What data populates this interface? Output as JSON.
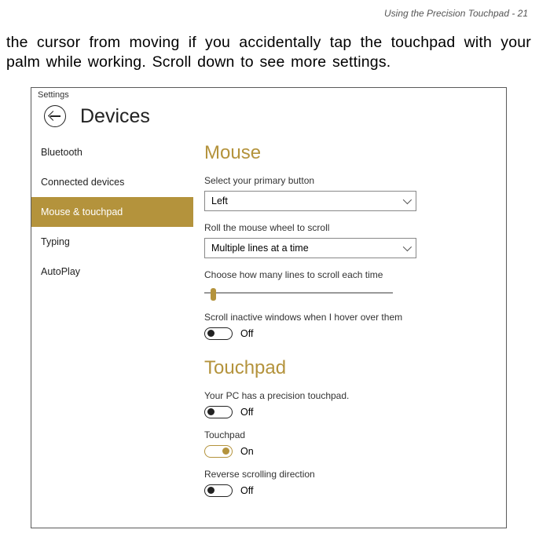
{
  "page_header": "Using the Precision Touchpad - 21",
  "body_text": "the cursor from moving if you accidentally tap the touchpad with your palm while working. Scroll down to see more settings.",
  "window_title": "Settings",
  "app_title": "Devices",
  "sidebar": {
    "items": [
      {
        "label": "Bluetooth",
        "active": false
      },
      {
        "label": "Connected devices",
        "active": false
      },
      {
        "label": "Mouse & touchpad",
        "active": true
      },
      {
        "label": "Typing",
        "active": false
      },
      {
        "label": "AutoPlay",
        "active": false
      }
    ]
  },
  "mouse": {
    "heading": "Mouse",
    "primary_button_label": "Select your primary button",
    "primary_button_value": "Left",
    "wheel_label": "Roll the mouse wheel to scroll",
    "wheel_value": "Multiple lines at a time",
    "lines_label": "Choose how many lines to scroll each time",
    "inactive_label": "Scroll inactive windows when I hover over them",
    "inactive_state": "Off"
  },
  "touchpad": {
    "heading": "Touchpad",
    "precision_text": "Your PC has a precision touchpad.",
    "precision_state": "Off",
    "touchpad_label": "Touchpad",
    "touchpad_state": "On",
    "reverse_label": "Reverse scrolling direction",
    "reverse_state": "Off"
  }
}
